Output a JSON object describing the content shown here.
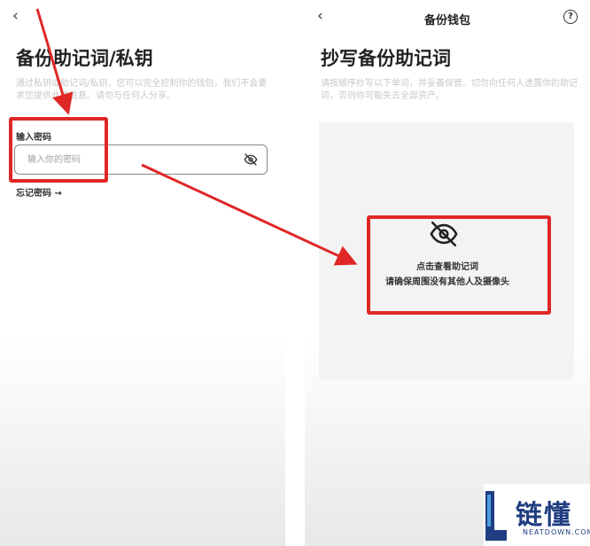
{
  "left_screen": {
    "back_glyph": "‹",
    "title": "备份助记词/私钥",
    "description": "通过私钥或助记词/私钥，您可以完全控制你的钱包，我们不会要求您提供此类信息。请勿与任何人分享。",
    "password_label": "输入密码",
    "password_placeholder": "输入你的密码",
    "eye_icon": "eye-off-icon",
    "forgot_password": "忘记密码 →"
  },
  "right_screen": {
    "back_glyph": "‹",
    "nav_title": "备份钱包",
    "help_glyph": "?",
    "title": "抄写备份助记词",
    "description": "请按顺序抄写以下单词，并妥善保管。切勿向任何人透露你的助记词，否则你可能失去全部资产。",
    "reveal_line1": "点击查看助记词",
    "reveal_line2": "请确保周围没有其他人及摄像头",
    "eye_icon": "eye-off-icon"
  },
  "annotation": {
    "color": "#e02727"
  },
  "watermark": {
    "text": "链懂",
    "sub": "NEATDOWN.COM",
    "color": "#1f3d80"
  }
}
